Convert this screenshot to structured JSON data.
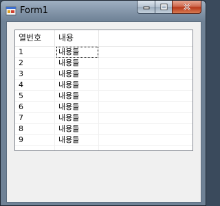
{
  "window": {
    "title": "Form1",
    "icon": "app-form-icon",
    "controls": [
      "minimize-icon",
      "maximize-icon",
      "close-icon"
    ]
  },
  "listview": {
    "columns": [
      "열번호",
      "내용"
    ],
    "rows": [
      {
        "no": "1",
        "content": "내용들"
      },
      {
        "no": "2",
        "content": "내용들"
      },
      {
        "no": "3",
        "content": "내용들"
      },
      {
        "no": "4",
        "content": "내용들"
      },
      {
        "no": "5",
        "content": "내용들"
      },
      {
        "no": "6",
        "content": "내용들"
      },
      {
        "no": "7",
        "content": "내용들"
      },
      {
        "no": "8",
        "content": "내용들"
      },
      {
        "no": "9",
        "content": "내용들"
      }
    ]
  },
  "colors": {
    "close_button": "#c4472a",
    "client_bg": "#f0f0f0",
    "listview_border": "#828790"
  }
}
